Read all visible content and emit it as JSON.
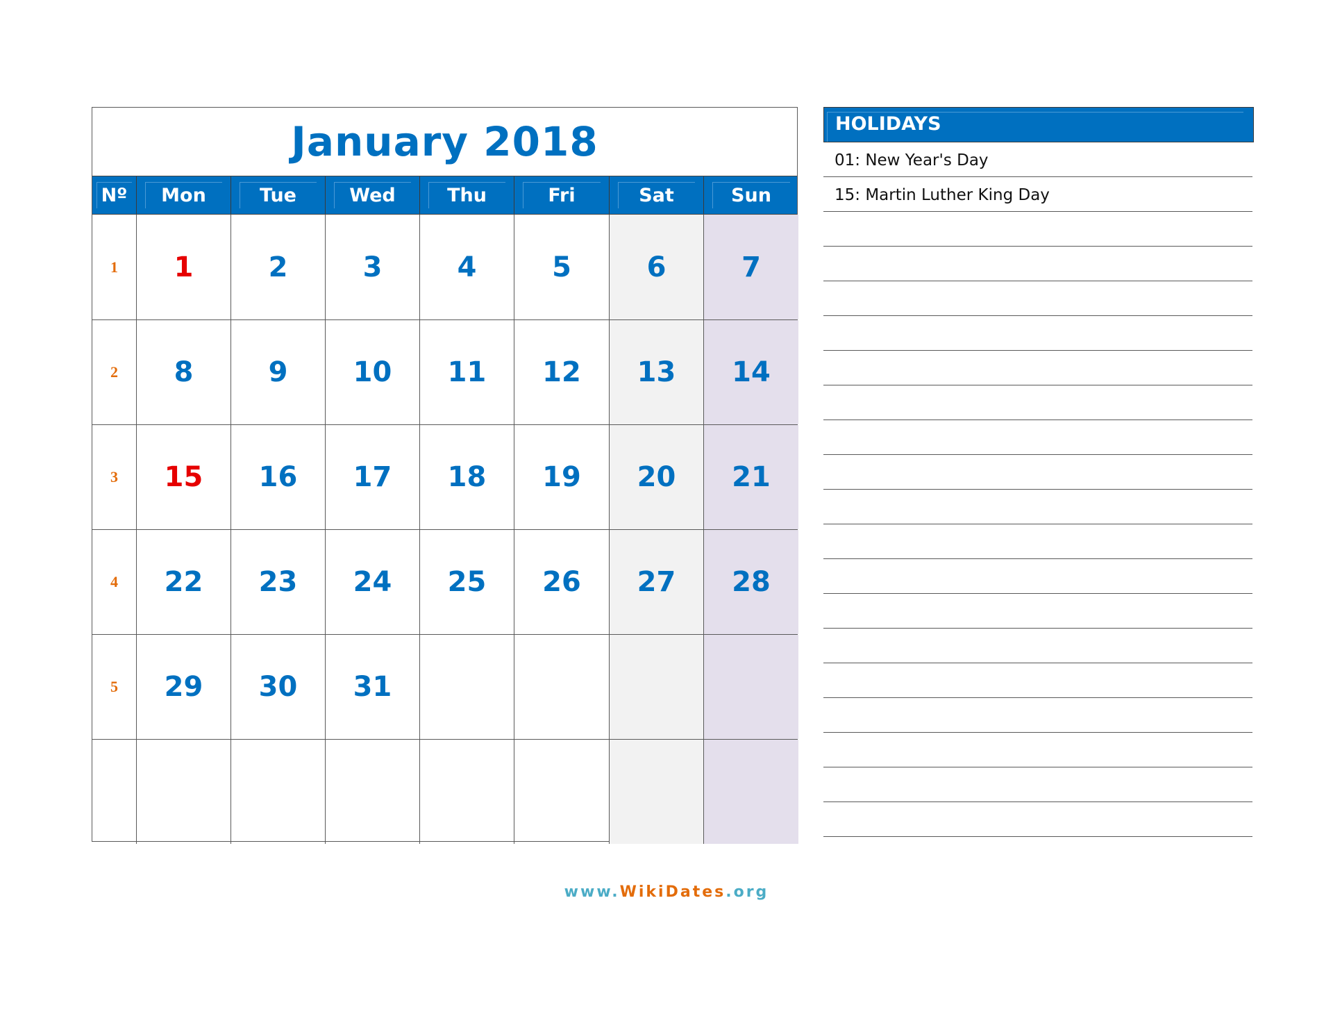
{
  "calendar": {
    "title": "January 2018",
    "header": [
      "Nº",
      "Mon",
      "Tue",
      "Wed",
      "Thu",
      "Fri",
      "Sat",
      "Sun"
    ],
    "weeks": [
      {
        "week": "1",
        "days": [
          "1",
          "2",
          "3",
          "4",
          "5",
          "6",
          "7"
        ]
      },
      {
        "week": "2",
        "days": [
          "8",
          "9",
          "10",
          "11",
          "12",
          "13",
          "14"
        ]
      },
      {
        "week": "3",
        "days": [
          "15",
          "16",
          "17",
          "18",
          "19",
          "20",
          "21"
        ]
      },
      {
        "week": "4",
        "days": [
          "22",
          "23",
          "24",
          "25",
          "26",
          "27",
          "28"
        ]
      },
      {
        "week": "5",
        "days": [
          "29",
          "30",
          "31",
          "",
          "",
          "",
          ""
        ]
      },
      {
        "week": "",
        "days": [
          "",
          "",
          "",
          "",
          "",
          "",
          ""
        ]
      }
    ],
    "holiday_days": [
      "1",
      "15"
    ],
    "colors": {
      "accent": "#0070c0",
      "holiday": "#e60000",
      "week_number": "#e36c0a",
      "saturday_bg": "#f2f2f2",
      "sunday_bg": "#e4dfec"
    }
  },
  "holidays": {
    "title": "HOLIDAYS",
    "items": [
      "01: New Year's Day",
      "15: Martin Luther King Day"
    ],
    "blank_lines": 18
  },
  "footer": {
    "prefix": "www.",
    "brand": "WikiDates",
    "suffix": ".org"
  }
}
